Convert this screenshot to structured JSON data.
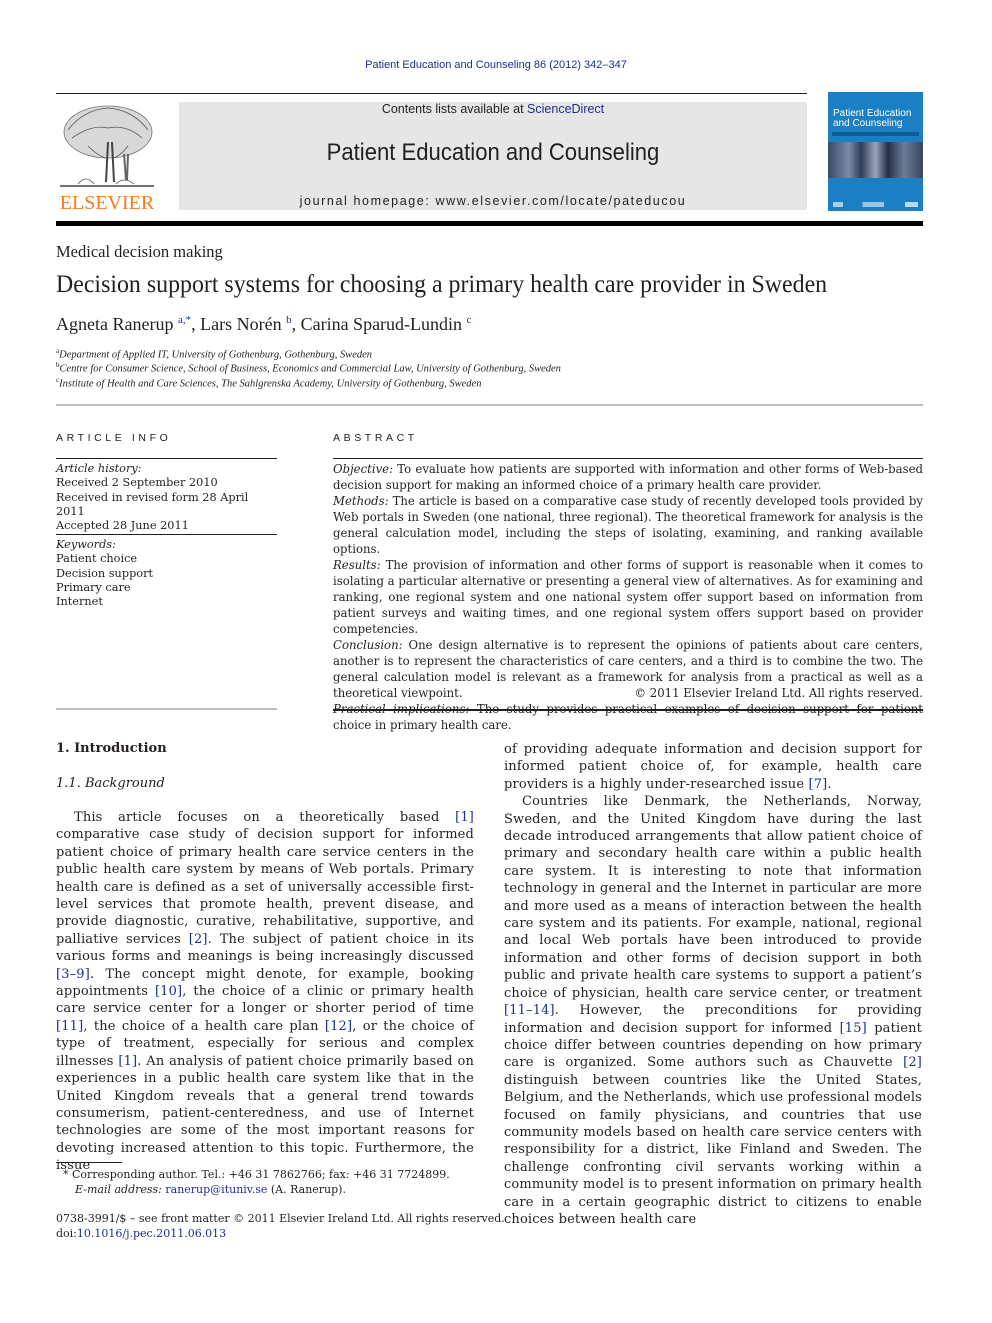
{
  "header": {
    "journal_citation": "Patient Education and Counseling 86 (2012) 342–347",
    "contents_prefix": "Contents lists available at ",
    "contents_link": "ScienceDirect",
    "journal_title": "Patient Education and Counseling",
    "homepage_label": "journal homepage: www.elsevier.com/locate/pateducou",
    "publisher_logo_text": "ELSEVIER",
    "cover": {
      "title_line1": "Patient Education",
      "title_line2": "and Counseling",
      "color": "#1c7fc4"
    }
  },
  "article": {
    "section": "Medical decision making",
    "title": "Decision support systems for choosing a primary health care provider in Sweden",
    "authors": [
      {
        "name": "Agneta Ranerup",
        "sup": "a,*"
      },
      {
        "name": "Lars Norén",
        "sup": "b"
      },
      {
        "name": "Carina Sparud-Lundin",
        "sup": "c"
      }
    ],
    "affiliations": [
      {
        "key": "a",
        "text": "Department of Applied IT, University of Gothenburg, Gothenburg, Sweden"
      },
      {
        "key": "b",
        "text": "Centre for Consumer Science, School of Business, Economics and Commercial Law, University of Gothenburg, Sweden"
      },
      {
        "key": "c",
        "text": "Institute of Health and Care Sciences, The Sahlgrenska Academy, University of Gothenburg, Sweden"
      }
    ]
  },
  "article_info": {
    "heading": "ARTICLE INFO",
    "history_label": "Article history:",
    "history": [
      "Received 2 September 2010",
      "Received in revised form 28 April 2011",
      "Accepted 28 June 2011"
    ],
    "keywords_label": "Keywords:",
    "keywords": [
      "Patient choice",
      "Decision support",
      "Primary care",
      "Internet"
    ]
  },
  "abstract": {
    "heading": "ABSTRACT",
    "sections": [
      {
        "label": "Objective:",
        "text": " To evaluate how patients are supported with information and other forms of Web-based decision support for making an informed choice of a primary health care provider."
      },
      {
        "label": "Methods:",
        "text": "  The article is based on a comparative case study of recently developed tools provided by Web portals in Sweden (one national, three regional). The theoretical framework for analysis is the general calculation model, including the steps of isolating, examining, and ranking available options."
      },
      {
        "label": "Results:",
        "text": "  The provision of information and other forms of support is reasonable when it comes to isolating a particular alternative or presenting a general view of alternatives. As for examining and ranking, one regional system and one national system offer support based on information from patient surveys and waiting times, and one regional system offers support based on provider competencies."
      },
      {
        "label": "Conclusion:",
        "text": "  One design alternative is to represent the opinions of patients about care centers, another is to represent the characteristics of care centers, and a third is to combine the two. The general calculation model is relevant as a framework for analysis from a practical as well as a theoretical viewpoint."
      },
      {
        "label": "Practical implications:",
        "text": "  The study provides practical examples of decision support for patient choice in primary health care."
      }
    ],
    "copyright": "© 2011 Elsevier Ireland Ltd. All rights reserved."
  },
  "body": {
    "heading_1": "1.  Introduction",
    "heading_1_1": "1.1.  Background",
    "left_paragraph": [
      {
        "t": "This article focuses on a theoretically based "
      },
      {
        "c": "[1]"
      },
      {
        "t": " comparative case study of decision support for informed patient choice of primary health care service centers in the public health care system by means of Web portals. Primary health care is defined as a set of universally accessible first-level services that promote health, prevent disease, and provide diagnostic, curative, rehabilitative, supportive, and palliative services "
      },
      {
        "c": "[2]"
      },
      {
        "t": ". The subject of patient choice in its various forms and meanings is being increasingly discussed "
      },
      {
        "c": "[3–9]"
      },
      {
        "t": ". The concept might denote, for example, booking appointments "
      },
      {
        "c": "[10]"
      },
      {
        "t": ", the choice of a clinic or primary health care service center for a longer or shorter period of time "
      },
      {
        "c": "[11]"
      },
      {
        "t": ", the choice of a health care plan "
      },
      {
        "c": "[12]"
      },
      {
        "t": ", or the choice of type of treatment, especially for serious and complex illnesses "
      },
      {
        "c": "[1]"
      },
      {
        "t": ". An analysis of patient choice primarily based on experiences in a public health care system like that in the United Kingdom reveals that a general trend towards consumerism, patient-centeredness, and use of Internet technologies are some of the most important reasons for devoting increased attention to this topic. Furthermore, the issue"
      }
    ],
    "right_paragraph_1": [
      {
        "t": "of providing adequate information and decision support for informed patient choice of, for example, health care providers is a highly under-researched issue "
      },
      {
        "c": "[7]"
      },
      {
        "t": "."
      }
    ],
    "right_paragraph_2": [
      {
        "t": "Countries like Denmark, the Netherlands, Norway, Sweden, and the United Kingdom have during the last decade introduced arrangements that allow patient choice of primary and secondary health care within a public health care system. It is interesting to note that information technology in general and the Internet in particular are more and more used as a means of interaction between the health care system and its patients. For example, national, regional and local Web portals have been introduced to provide information and other forms of decision support in both public and private health care systems to support a patient’s choice of physician, health care service center, or treatment "
      },
      {
        "c": "[11–14]"
      },
      {
        "t": ". However, the preconditions for providing information and decision support for informed "
      },
      {
        "c": "[15]"
      },
      {
        "t": " patient choice differ between countries depending on how primary care is organized. Some authors such as Chauvette "
      },
      {
        "c": "[2]"
      },
      {
        "t": " distinguish between countries like the United States, Belgium, and the Netherlands, which use professional models focused on family physicians, and countries that use community models based on health care service centers with responsibility for a district, like Finland and Sweden. The challenge confronting civil servants working within a community model is to present information on primary health care in a certain geographic district to citizens to enable choices between health care"
      }
    ]
  },
  "footnote": {
    "marker": "*",
    "corresponding": " Corresponding author. Tel.: +46 31 7862766; fax: +46 31 7724899.",
    "email_label": "E-mail address:",
    "email": "ranerup@ituniv.se",
    "email_suffix": " (A. Ranerup)."
  },
  "front_matter": {
    "issn_line": "0738-3991/$ – see front matter © 2011 Elsevier Ireland Ltd. All rights reserved.",
    "doi_prefix": "doi:",
    "doi": "10.1016/j.pec.2011.06.013"
  }
}
